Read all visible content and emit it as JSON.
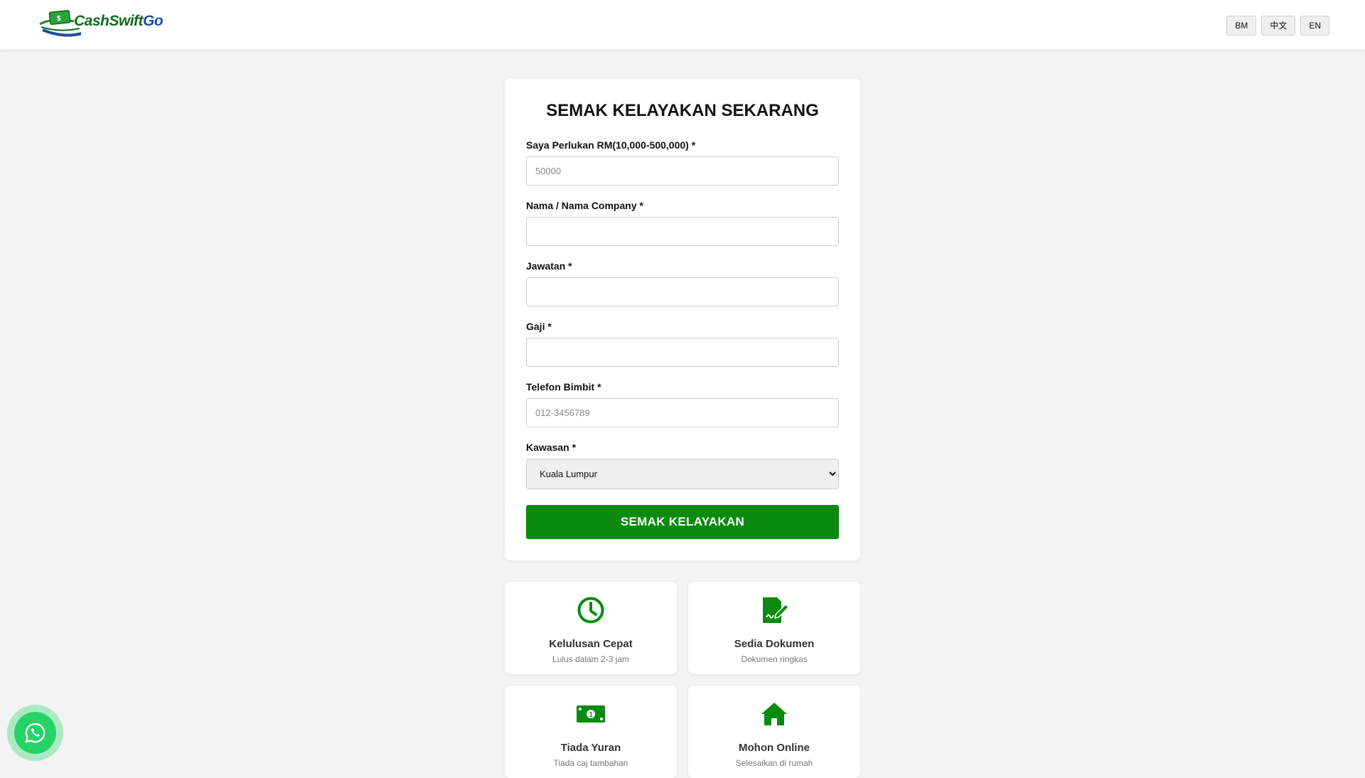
{
  "header": {
    "logo_text_main": "CashSwift",
    "logo_text_accent": "Go",
    "languages": [
      "BM",
      "中文",
      "EN"
    ]
  },
  "form": {
    "title": "SEMAK KELAYAKAN SEKARANG",
    "fields": [
      {
        "label": "Saya Perlukan RM(10,000-500,000) *",
        "placeholder": "50000",
        "value": ""
      },
      {
        "label": "Nama / Nama Company *",
        "placeholder": "",
        "value": ""
      },
      {
        "label": "Jawatan *",
        "placeholder": "",
        "value": ""
      },
      {
        "label": "Gaji *",
        "placeholder": "",
        "value": ""
      },
      {
        "label": "Telefon Bimbit *",
        "placeholder": "012-3456789",
        "value": ""
      }
    ],
    "region": {
      "label": "Kawasan *",
      "selected": "Kuala Lumpur"
    },
    "submit_label": "SEMAK KELAYAKAN"
  },
  "features": [
    {
      "icon": "clock-icon",
      "title": "Kelulusan Cepat",
      "subtitle": "Lulus dalam 2-3 jam"
    },
    {
      "icon": "document-sign-icon",
      "title": "Sedia Dokumen",
      "subtitle": "Dokumen ringkas"
    },
    {
      "icon": "money-bill-icon",
      "title": "Tiada Yuran",
      "subtitle": "Tiada caj tambahan"
    },
    {
      "icon": "home-icon",
      "title": "Mohon Online",
      "subtitle": "Selesaikan di rumah"
    }
  ],
  "floating": {
    "icon": "whatsapp-icon"
  },
  "colors": {
    "primary_green": "#0a8a0f",
    "whatsapp": "#25d366",
    "logo_blue": "#1a4fa0"
  }
}
